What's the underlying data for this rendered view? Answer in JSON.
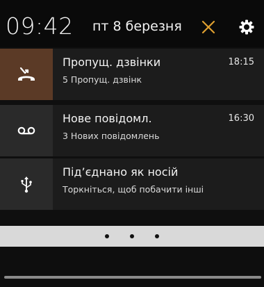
{
  "header": {
    "time": "09:42",
    "date": "пт 8 березня",
    "clear_icon": "close-icon",
    "settings_icon": "gear-icon",
    "accent_color": "#e0a030"
  },
  "notifications": [
    {
      "icon": "missed-call-icon",
      "icon_bg": "#5b3a26",
      "title": "Пропущ. дзвінки",
      "text": "5 Пропущ. дзвінк",
      "time": "18:15"
    },
    {
      "icon": "voicemail-icon",
      "icon_bg": "#2a2a2a",
      "title": "Нове повідомл.",
      "text": "3 Нових повідомлень",
      "time": "16:30"
    },
    {
      "icon": "usb-icon",
      "icon_bg": "#2a2a2a",
      "title": "Під’єднано як носій",
      "text": "Торкніться, щоб побачити інші",
      "time": ""
    }
  ],
  "pager": {
    "dots": 3
  }
}
